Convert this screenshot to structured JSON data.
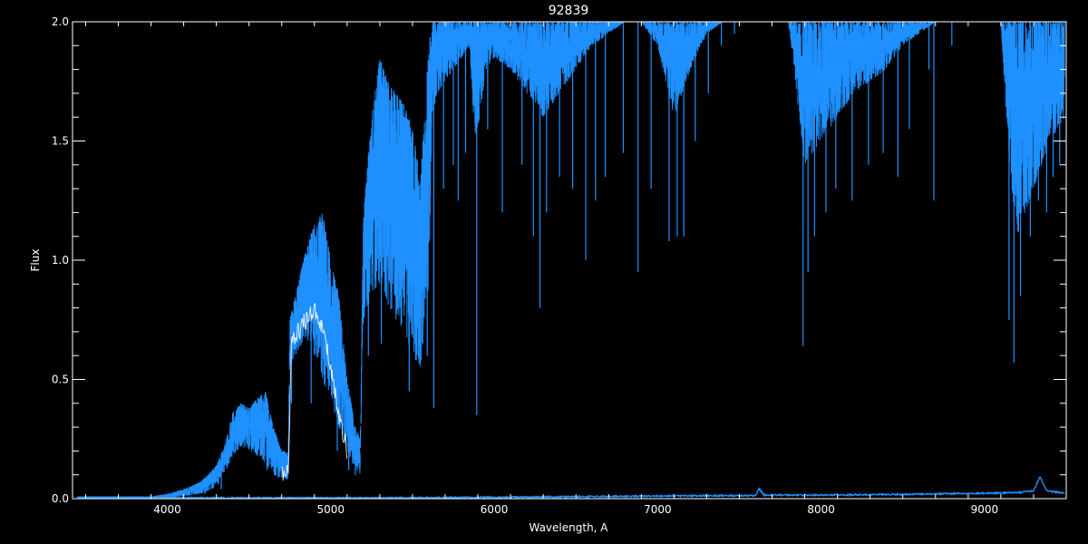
{
  "chart_data": {
    "type": "line",
    "title": "92839",
    "xlabel": "Wavelength, A",
    "ylabel": "Flux",
    "xlim": [
      3420,
      9500
    ],
    "ylim": [
      0,
      2.0
    ],
    "grid": false,
    "legend": "none",
    "x_ticks": [
      4000,
      5000,
      6000,
      7000,
      8000,
      9000
    ],
    "x_tick_labels": [
      "4000",
      "5000",
      "6000",
      "7000",
      "8000",
      "9000"
    ],
    "y_ticks": [
      0,
      0.5,
      1.0,
      1.5,
      2.0
    ],
    "y_tick_labels": [
      "0.0",
      "0.5",
      "1.0",
      "1.5",
      "2.0"
    ],
    "colors": {
      "spectrum": "#1e90ff",
      "mean": "#ffffff",
      "axes": "#ffffff",
      "background": "#000000"
    },
    "series": [
      {
        "role": "envelope",
        "x": [
          3450,
          3600,
          3800,
          3900,
          4000,
          4100,
          4200,
          4250,
          4300,
          4350,
          4400,
          4450,
          4500,
          4550,
          4600,
          4650,
          4700,
          4740,
          4750,
          4800,
          4850,
          4900,
          4950,
          5000,
          5050,
          5100,
          5150,
          5180,
          5200,
          5250,
          5300,
          5350,
          5400,
          5450,
          5500,
          5550,
          5600,
          5620,
          5650,
          5700,
          5750,
          5800,
          5850,
          5880,
          5900,
          5950,
          6000,
          6100,
          6200,
          6300,
          6400,
          6500,
          6600,
          6700,
          6800,
          6900,
          7000,
          7100,
          7200,
          7300,
          7400,
          7500,
          7600,
          7700,
          7800,
          7850,
          7900,
          8000,
          8100,
          8200,
          8300,
          8400,
          8500,
          8600,
          8700,
          8800,
          8900,
          9000,
          9100,
          9150,
          9200,
          9250,
          9300,
          9350,
          9400,
          9450,
          9490
        ],
        "upper": [
          0.01,
          0.01,
          0.01,
          0.01,
          0.02,
          0.04,
          0.07,
          0.1,
          0.14,
          0.22,
          0.36,
          0.4,
          0.38,
          0.42,
          0.45,
          0.3,
          0.2,
          0.2,
          0.75,
          0.9,
          1.05,
          1.15,
          1.2,
          1.0,
          0.85,
          0.5,
          0.3,
          0.25,
          1.2,
          1.6,
          1.85,
          1.75,
          1.7,
          1.65,
          1.55,
          1.35,
          1.9,
          2.0,
          2.0,
          2.0,
          2.0,
          2.0,
          2.0,
          2.0,
          2.0,
          2.0,
          2.0,
          2.0,
          2.0,
          2.0,
          2.0,
          2.0,
          2.0,
          2.0,
          2.0,
          2.0,
          2.0,
          2.0,
          2.0,
          2.0,
          2.0,
          2.0,
          2.0,
          2.0,
          2.0,
          2.0,
          2.0,
          2.0,
          2.0,
          2.0,
          2.0,
          2.0,
          2.0,
          2.0,
          2.0,
          2.0,
          2.0,
          2.0,
          2.0,
          2.0,
          2.0,
          2.0,
          2.0,
          2.0,
          2.0,
          2.0,
          2.0
        ],
        "lower": [
          0.0,
          0.0,
          0.0,
          0.0,
          0.0,
          0.01,
          0.02,
          0.03,
          0.05,
          0.1,
          0.18,
          0.22,
          0.2,
          0.18,
          0.15,
          0.1,
          0.08,
          0.08,
          0.55,
          0.62,
          0.68,
          0.6,
          0.5,
          0.4,
          0.3,
          0.2,
          0.12,
          0.1,
          0.75,
          0.85,
          0.9,
          0.8,
          0.75,
          0.7,
          0.6,
          0.55,
          0.9,
          1.6,
          1.7,
          1.75,
          1.8,
          1.85,
          1.9,
          1.5,
          1.55,
          1.8,
          1.85,
          1.8,
          1.7,
          1.6,
          1.7,
          1.8,
          1.9,
          1.95,
          2.0,
          2.0,
          1.9,
          1.6,
          1.8,
          1.95,
          2.0,
          2.0,
          2.0,
          2.0,
          2.0,
          1.7,
          1.4,
          1.5,
          1.6,
          1.7,
          1.75,
          1.8,
          1.9,
          1.95,
          2.0,
          2.0,
          2.0,
          2.0,
          2.0,
          1.4,
          1.1,
          1.2,
          1.3,
          1.4,
          1.5,
          1.55,
          1.6
        ],
        "dips": [
          [
            3850,
            0.0
          ],
          [
            4230,
            0.02
          ],
          [
            4330,
            0.04
          ],
          [
            4610,
            0.12
          ],
          [
            4760,
            0.4
          ],
          [
            4880,
            0.4
          ],
          [
            5040,
            0.2
          ],
          [
            5110,
            0.12
          ],
          [
            5150,
            0.1
          ],
          [
            5230,
            0.6
          ],
          [
            5310,
            0.65
          ],
          [
            5480,
            0.45
          ],
          [
            5590,
            0.6
          ],
          [
            5630,
            0.38
          ],
          [
            5690,
            1.3
          ],
          [
            5750,
            1.4
          ],
          [
            5780,
            1.25
          ],
          [
            5825,
            1.45
          ],
          [
            5893,
            0.35
          ],
          [
            5960,
            1.55
          ],
          [
            6050,
            1.2
          ],
          [
            6170,
            1.4
          ],
          [
            6240,
            1.1
          ],
          [
            6280,
            0.8
          ],
          [
            6320,
            1.2
          ],
          [
            6400,
            1.35
          ],
          [
            6480,
            1.3
          ],
          [
            6560,
            1.0
          ],
          [
            6620,
            1.25
          ],
          [
            6680,
            1.35
          ],
          [
            6790,
            1.45
          ],
          [
            6880,
            0.95
          ],
          [
            6960,
            1.3
          ],
          [
            7070,
            1.08
          ],
          [
            7120,
            1.1
          ],
          [
            7160,
            1.1
          ],
          [
            7230,
            1.5
          ],
          [
            7310,
            1.7
          ],
          [
            7390,
            1.9
          ],
          [
            7470,
            1.95
          ],
          [
            7890,
            0.64
          ],
          [
            7920,
            0.95
          ],
          [
            7960,
            1.1
          ],
          [
            8030,
            1.2
          ],
          [
            8090,
            1.3
          ],
          [
            8190,
            1.25
          ],
          [
            8290,
            1.4
          ],
          [
            8380,
            1.45
          ],
          [
            8470,
            1.35
          ],
          [
            8540,
            1.55
          ],
          [
            8660,
            1.8
          ],
          [
            8690,
            1.25
          ],
          [
            8800,
            1.9
          ],
          [
            9150,
            0.75
          ],
          [
            9180,
            0.57
          ],
          [
            9220,
            0.85
          ],
          [
            9280,
            1.1
          ],
          [
            9330,
            1.25
          ],
          [
            9380,
            1.2
          ],
          [
            9420,
            1.35
          ],
          [
            9460,
            1.4
          ]
        ]
      },
      {
        "role": "mean",
        "x": [
          4700,
          4740,
          4760,
          4800,
          4850,
          4900,
          4950,
          5000,
          5050,
          5100
        ],
        "y": [
          0.1,
          0.12,
          0.65,
          0.7,
          0.75,
          0.8,
          0.72,
          0.55,
          0.35,
          0.2
        ]
      },
      {
        "role": "error",
        "x": [
          3450,
          4000,
          4500,
          5000,
          5500,
          6000,
          6500,
          7000,
          7500,
          7600,
          7620,
          7650,
          8000,
          8500,
          9000,
          9200,
          9300,
          9340,
          9380,
          9490
        ],
        "y": [
          0.0,
          0.0,
          0.0,
          0.0,
          0.0,
          0.003,
          0.005,
          0.008,
          0.01,
          0.01,
          0.04,
          0.012,
          0.012,
          0.015,
          0.02,
          0.022,
          0.03,
          0.09,
          0.03,
          0.02
        ]
      }
    ]
  }
}
